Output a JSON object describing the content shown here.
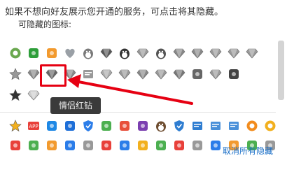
{
  "dialog": {
    "notice_text": "如果不想向好友展示您开通的服务，可点击将其隐藏。",
    "hideable_icons_label": "可隐藏的图标:",
    "tooltip_text": "情侣红钻",
    "unhide_all_link": "取消所有隐藏"
  },
  "icon_rows": [
    [
      {
        "name": "badge-ball-icon",
        "color": "#6aa84f"
      },
      {
        "name": "game-icon",
        "color": "#2e9e3a"
      },
      {
        "name": "pet-icon",
        "color": "#f29a2e"
      },
      {
        "name": "heart-icon",
        "color": "#9aa0a6"
      },
      {
        "name": "qq-penguin-icon",
        "color": "#7a7a7a"
      },
      {
        "name": "dark-diamond-icon",
        "color": "#555555"
      },
      {
        "name": "qq-penguin-dark-icon",
        "color": "#333333"
      },
      {
        "name": "speed-diamond-icon",
        "color": "#999999"
      },
      {
        "name": "robot-icon",
        "color": "#555555"
      },
      {
        "name": "crown-diamond-icon",
        "color": "#888888"
      },
      {
        "name": "lightning-diamond-icon",
        "color": "#888888"
      },
      {
        "name": "level-diamond-icon",
        "color": "#999999"
      },
      {
        "name": "vip-diamond-icon",
        "color": "#999999"
      },
      {
        "name": "music-diamond-icon",
        "color": "#999999"
      }
    ],
    [
      {
        "name": "star-icon",
        "color": "#999999"
      },
      {
        "name": "super-diamond-icon",
        "color": "#888888"
      },
      {
        "name": "couple-red-diamond-icon",
        "color": "#666666"
      },
      {
        "name": "green-diamond-icon",
        "color": "#888888"
      },
      {
        "name": "book-icon",
        "color": "#999999"
      },
      {
        "name": "light-diamond-icon",
        "color": "#aaaaaa"
      },
      {
        "name": "pink-diamond-icon",
        "color": "#999999"
      },
      {
        "name": "gem-diamond-icon",
        "color": "#888888"
      },
      {
        "name": "yellow-diamond-icon",
        "color": "#999999"
      },
      {
        "name": "flower-diamond-icon",
        "color": "#777777"
      },
      {
        "name": "sword-icon",
        "color": "#666666"
      },
      {
        "name": "cloud-diamond-icon",
        "color": "#999999"
      },
      {
        "name": "dragon-icon",
        "color": "#444444"
      }
    ],
    [
      {
        "name": "dark-star-icon",
        "color": "#333333"
      },
      {
        "name": "pale-diamond-icon",
        "color": "#cccccc"
      }
    ],
    [
      {
        "name": "star-badge-icon",
        "color": "#f2b01e"
      },
      {
        "name": "app-icon",
        "color": "#e8403a"
      },
      {
        "name": "camera-icon",
        "color": "#1e88e5"
      },
      {
        "name": "kite-icon",
        "color": "#1e6fd8"
      },
      {
        "name": "shield-icon",
        "color": "#2b7de9"
      },
      {
        "name": "plant-icon",
        "color": "#4caf50"
      },
      {
        "name": "pet-orange-icon",
        "color": "#e8503a"
      },
      {
        "name": "tetris-icon",
        "color": "#7b3fb0"
      },
      {
        "name": "cow-icon",
        "color": "#6d4c2f"
      },
      {
        "name": "shield-blue-icon",
        "color": "#2e7dd1"
      },
      {
        "name": "letter-l-icon",
        "color": "#2e7dd1"
      },
      {
        "name": "note-icon",
        "color": "#4a90d9"
      },
      {
        "name": "mail-icon",
        "color": "#4a90d9"
      },
      {
        "name": "orange-ring-icon",
        "color": "#f28c1e"
      },
      {
        "name": "flower-badge-icon",
        "color": "#f2b01e"
      }
    ],
    [
      {
        "name": "partial-icon-1",
        "color": "#e8403a"
      },
      {
        "name": "partial-icon-2",
        "color": "#4caf50"
      },
      {
        "name": "partial-icon-3",
        "color": "#f29a2e"
      },
      {
        "name": "partial-icon-4",
        "color": "#2b7de9"
      },
      {
        "name": "partial-icon-5",
        "color": "#999999"
      },
      {
        "name": "partial-icon-6",
        "color": "#e8403a"
      },
      {
        "name": "partial-icon-7",
        "color": "#2b7de9"
      },
      {
        "name": "partial-icon-8",
        "color": "#f2b01e"
      },
      {
        "name": "partial-icon-9",
        "color": "#4caf50"
      },
      {
        "name": "partial-icon-10",
        "color": "#e8403a"
      },
      {
        "name": "partial-icon-11",
        "color": "#999999"
      },
      {
        "name": "partial-icon-12",
        "color": "#2b7de9"
      },
      {
        "name": "partial-icon-13",
        "color": "#f29a2e"
      },
      {
        "name": "partial-icon-14",
        "color": "#4caf50"
      },
      {
        "name": "partial-icon-15",
        "color": "#999999"
      }
    ]
  ],
  "accent_colors": {
    "highlight": "#e60012",
    "link": "#1a6fc8",
    "tooltip_bg": "#3a3a3a"
  }
}
